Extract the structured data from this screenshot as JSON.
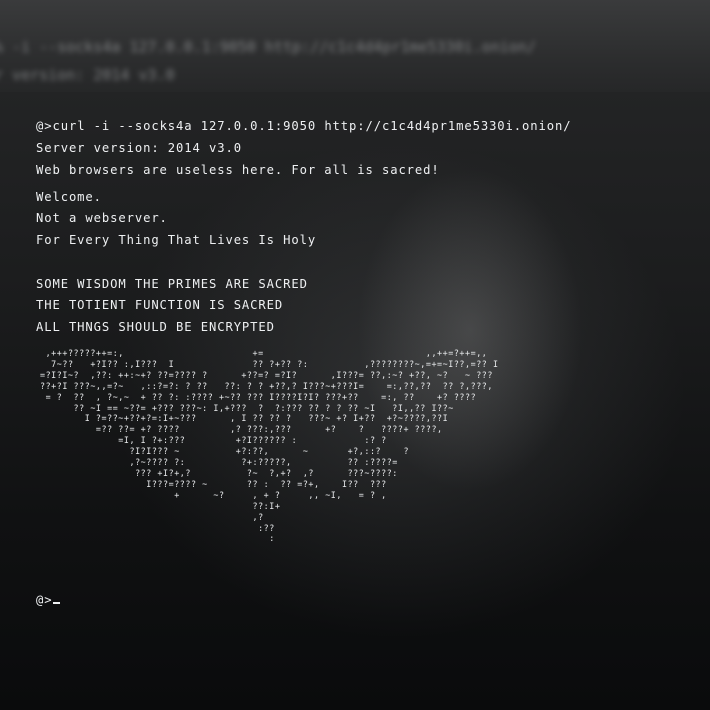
{
  "background_ghost": {
    "line1": "% -i --socks4a 127.0.0.1:9050 http://c1c4d4pr1me5330i.onion/",
    "line2": "r version: 2014 v3.0"
  },
  "terminal": {
    "prompt_symbol": "@>",
    "command": "curl -i --socks4a 127.0.0.1:9050 http://c1c4d4pr1me5330i.onion/",
    "response_lines": [
      "Server version: 2014 v3.0",
      "Web browsers are useless here. For all is sacred!",
      "Welcome.",
      "Not a webserver.",
      "For Every Thing That Lives Is Holy",
      "SOME WISDOM THE PRIMES ARE SACRED",
      "THE TOTIENT FUNCTION IS SACRED",
      "ALL THNGS SHOULD BE ENCRYPTED"
    ],
    "ascii_art": [
      " ,+++?????++=:,                       +=                             ,,++=?++=,,",
      "  7~??   +?I?? :,I???  I              ?? ?+?? ?:          ,????????~,=+=~I??,=?? I",
      "=?I?I~?  ,??: ++:~+? ??=???? ?      +??=? =?I?      ,I???= ??,:~? +??, ~?   ~ ???",
      "??+?I ???~,,=?~   ,::?=?: ? ??   ??: ? ? +??,? I???~+???I=    =:,??,??  ?? ?,???,",
      " = ?  ??  , ?~,~  + ?? ?: :???? +~?? ??? I????I?I? ???+??    =:, ??    +? ????",
      "      ?? ~I == ~??= +??? ???~: I,+???  ?  ?:??? ?? ? ? ?? ~I   ?I,,?? I??~",
      "        I ?=??~+??+?=:I+~???      , I ?? ?? ?   ???~ +? I+??  +?~????,??I",
      "          =?? ??= +? ????         ,? ???:,???      +?    ?   ????+ ????,",
      "              =I, I ?+:???         +?I?????? :            :? ?",
      "                ?I?I??? ~          +?:??,      ~       +?,::?    ?",
      "                ,?~???? ?:          ?+:?????,          ?? :????=",
      "                 ??? +I?+,?          ?~  ?,+?  ,?      ???~????:",
      "                   I???=???? ~       ?? :  ?? =?+,    I??  ???",
      "                        +      ~?     , + ?     ,, ~I,   = ? ,",
      "                                      ??:I+",
      "                                      ,?",
      "                                       :??",
      "                                         :"
    ],
    "final_prompt": "@>"
  }
}
